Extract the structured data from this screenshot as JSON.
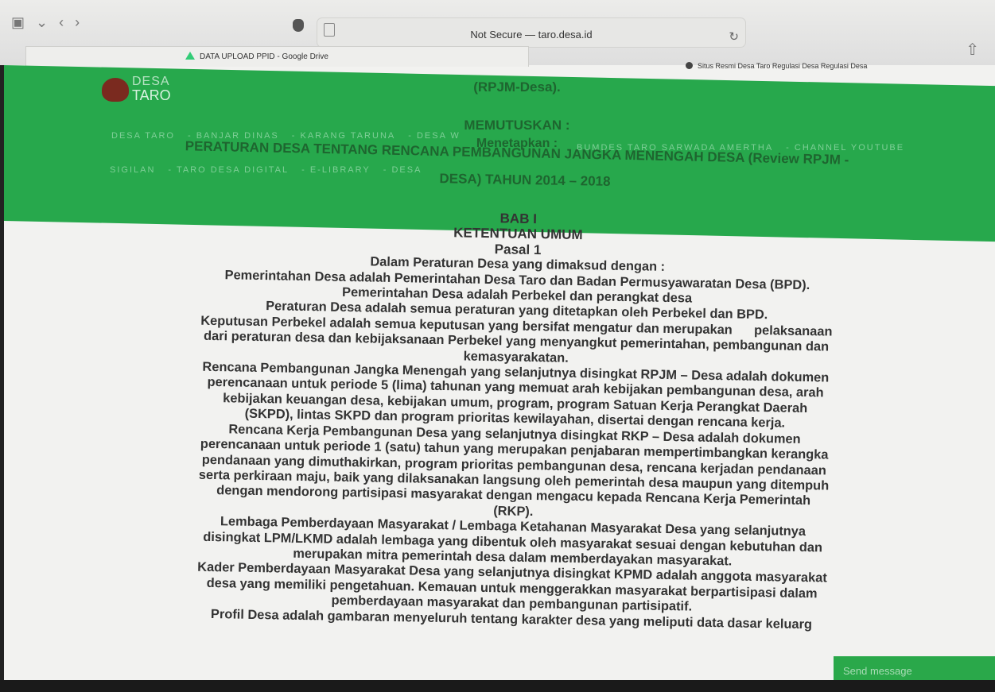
{
  "browser": {
    "url": "Not Secure — taro.desa.id",
    "tab_active": "DATA UPLOAD PPID - Google Drive",
    "tab_other": "Situs Resmi Desa Taro Regulasi Desa Regulasi Desa"
  },
  "site": {
    "logo_top": "DESA",
    "logo_bottom": "TARO",
    "nav_row1": [
      "DESA TARO",
      "BANJAR DINAS",
      "KARANG TARUNA",
      "DESA W"
    ],
    "nav_row1b": [
      "BUMDES TARO SARWADA AMERTHA",
      "CHANNEL YOUTUBE"
    ],
    "nav_row2": [
      "SIGILAN",
      "TARO DESA DIGITAL",
      "E-LIBRARY",
      "DESA"
    ]
  },
  "header_text": {
    "rpjm": "(RPJM-Desa).",
    "memutuskan": "MEMUTUSKAN :",
    "menetapkan": "Menetapkan :",
    "peraturan": "PERATURAN DESA TENTANG RENCANA PEMBANGUNAN JANGKA MENENGAH DESA (Review RPJM -",
    "desa_tahun": "DESA) TAHUN 2014 – 2018"
  },
  "document": {
    "bab": "BAB I",
    "ketentuan": "KETENTUAN UMUM",
    "pasal": "Pasal 1",
    "lines": [
      "Dalam Peraturan Desa yang dimaksud dengan :",
      "Pemerintahan Desa adalah Pemerintahan Desa Taro dan Badan Permusyawaratan Desa (BPD).",
      "Pemerintahan Desa adalah Perbekel dan perangkat desa",
      "Peraturan Desa adalah semua peraturan yang ditetapkan oleh Perbekel dan BPD.",
      "Keputusan Perbekel adalah semua keputusan yang bersifat mengatur dan merupakan      pelaksanaan",
      "dari peraturan desa dan kebijaksanaan Perbekel yang menyangkut pemerintahan, pembangunan dan",
      "kemasyarakatan.",
      "Rencana Pembangunan Jangka Menengah yang selanjutnya disingkat RPJM – Desa adalah dokumen",
      "perencanaan untuk periode 5 (lima) tahunan yang memuat arah kebijakan pembangunan desa, arah",
      "kebijakan keuangan desa, kebijakan umum, program, program Satuan Kerja Perangkat Daerah",
      "(SKPD), lintas SKPD dan program prioritas kewilayahan, disertai dengan rencana kerja.",
      "Rencana Kerja Pembangunan Desa yang selanjutnya disingkat RKP – Desa adalah dokumen",
      "perencanaan untuk periode 1 (satu) tahun yang merupakan penjabaran mempertimbangkan kerangka",
      "pendanaan yang dimuthakirkan, program prioritas pembangunan desa, rencana kerjadan pendanaan",
      "serta perkiraan maju, baik yang dilaksanakan langsung oleh pemerintah desa maupun yang ditempuh",
      "dengan mendorong partisipasi masyarakat dengan mengacu kepada Rencana Kerja Pemerintah",
      "(RKP).",
      "Lembaga Pemberdayaan Masyarakat / Lembaga Ketahanan Masyarakat Desa yang selanjutnya",
      "disingkat LPM/LKMD adalah lembaga yang dibentuk oleh masyarakat sesuai dengan kebutuhan dan",
      "merupakan mitra pemerintah desa dalam memberdayakan masyarakat.",
      "Kader Pemberdayaan Masyarakat Desa yang selanjutnya disingkat KPMD adalah anggota masyarakat",
      "desa yang memiliki pengetahuan. Kemauan untuk menggerakkan masyarakat berpartisipasi dalam",
      "pemberdayaan masyarakat dan pembangunan partisipatif.",
      "Profil Desa adalah gambaran menyeluruh tentang karakter desa yang meliputi data dasar keluarg"
    ]
  },
  "chat": {
    "send_label": "Send message"
  }
}
